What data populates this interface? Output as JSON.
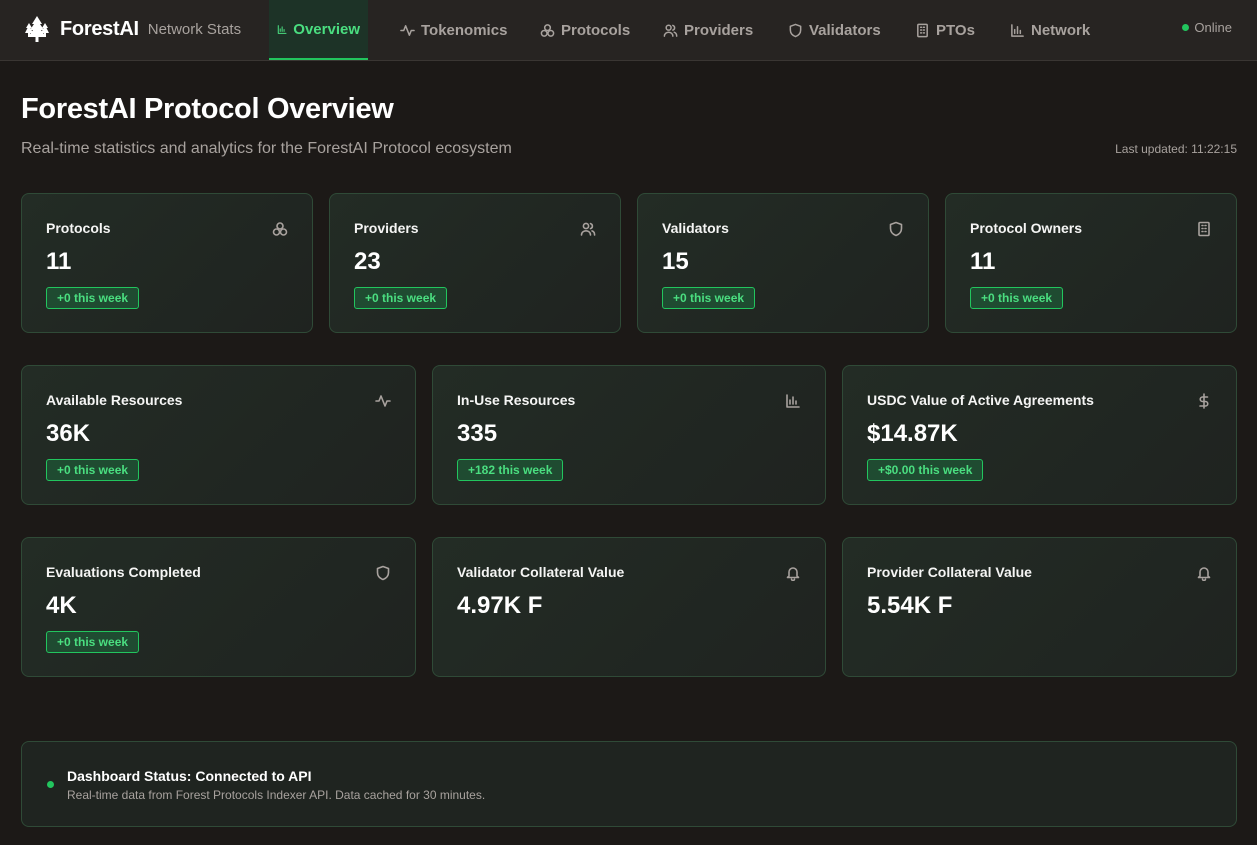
{
  "nav": {
    "brand": "ForestAI",
    "subtitle": "Network Stats",
    "tabs": [
      {
        "label": "Overview",
        "icon": "bar-chart-icon",
        "active": true
      },
      {
        "label": "Tokenomics",
        "icon": "activity-icon"
      },
      {
        "label": "Protocols",
        "icon": "cubes-icon"
      },
      {
        "label": "Providers",
        "icon": "users-icon"
      },
      {
        "label": "Validators",
        "icon": "shield-icon"
      },
      {
        "label": "PTOs",
        "icon": "building-icon"
      },
      {
        "label": "Network",
        "icon": "bar-chart-icon"
      }
    ],
    "status": "Online"
  },
  "header": {
    "title": "ForestAI Protocol Overview",
    "subtitle": "Real-time statistics and analytics for the ForestAI Protocol ecosystem",
    "last_updated": "Last updated: 11:22:15"
  },
  "stats_row1": [
    {
      "title": "Protocols",
      "value": "11",
      "badge": "+0 this week",
      "icon": "cubes-icon"
    },
    {
      "title": "Providers",
      "value": "23",
      "badge": "+0 this week",
      "icon": "users-icon"
    },
    {
      "title": "Validators",
      "value": "15",
      "badge": "+0 this week",
      "icon": "shield-icon"
    },
    {
      "title": "Protocol Owners",
      "value": "11",
      "badge": "+0 this week",
      "icon": "building-icon"
    }
  ],
  "stats_row2": [
    {
      "title": "Available Resources",
      "value": "36K",
      "badge": "+0 this week",
      "icon": "activity-icon"
    },
    {
      "title": "In-Use Resources",
      "value": "335",
      "badge": "+182 this week",
      "icon": "bar-chart-icon"
    },
    {
      "title": "USDC Value of Active Agreements",
      "value": "$14.87K",
      "badge": "+$0.00 this week",
      "icon": "dollar-icon"
    }
  ],
  "stats_row3": [
    {
      "title": "Evaluations Completed",
      "value": "4K",
      "badge": "+0 this week",
      "icon": "shield-icon"
    },
    {
      "title": "Validator Collateral Value",
      "value": "4.97K F",
      "icon": "bell-icon"
    },
    {
      "title": "Provider Collateral Value",
      "value": "5.54K F",
      "icon": "bell-icon"
    }
  ],
  "dashboard_status": {
    "title": "Dashboard Status: Connected to API",
    "description": "Real-time data from Forest Protocols Indexer API. Data cached for 30 minutes."
  },
  "colors": {
    "background": "#1c1917",
    "accent": "#22c55e",
    "accent_text": "#4ade80",
    "muted_text": "#a8a29e"
  }
}
